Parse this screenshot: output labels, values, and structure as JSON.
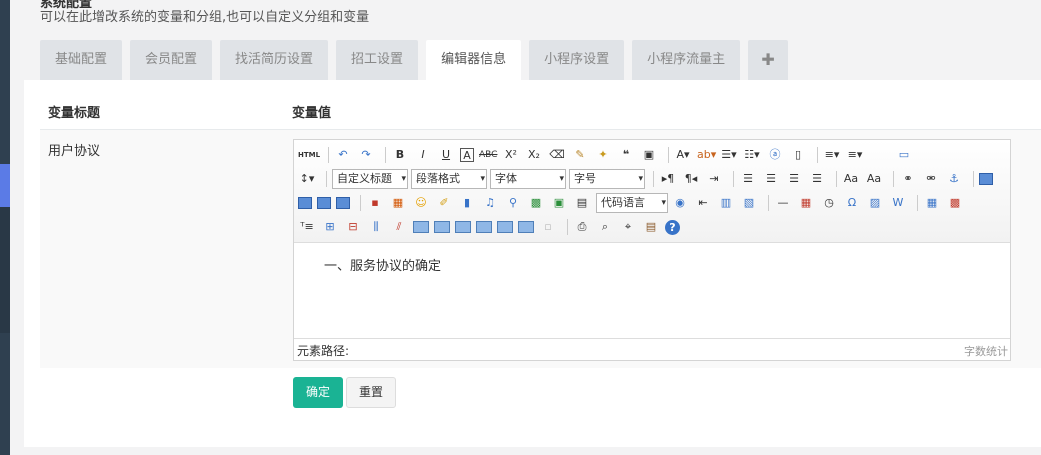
{
  "page": {
    "title": "系统配置",
    "description": "可以在此增改系统的变量和分组,也可以自定义分组和变量"
  },
  "tabs": [
    {
      "label": "基础配置"
    },
    {
      "label": "会员配置"
    },
    {
      "label": "找活简历设置"
    },
    {
      "label": "招工设置"
    },
    {
      "label": "编辑器信息",
      "active": true
    },
    {
      "label": "小程序设置"
    },
    {
      "label": "小程序流量主"
    },
    {
      "label": "✚"
    }
  ],
  "table": {
    "col_title": "变量标题",
    "col_value": "变量值",
    "row_label": "用户协议"
  },
  "editor": {
    "font_family_options": [
      "自定义标题",
      "段落格式",
      "字体",
      "字号"
    ],
    "code_lang": "代码语言",
    "content": "一、服务协议的确定",
    "path_label": "元素路径:",
    "word_count_label": "字数统计"
  },
  "actions": {
    "confirm_label": "确定",
    "reset_label": "重置"
  },
  "colors": {
    "primary": "#1ab394",
    "sidebar": "#2f4050"
  }
}
